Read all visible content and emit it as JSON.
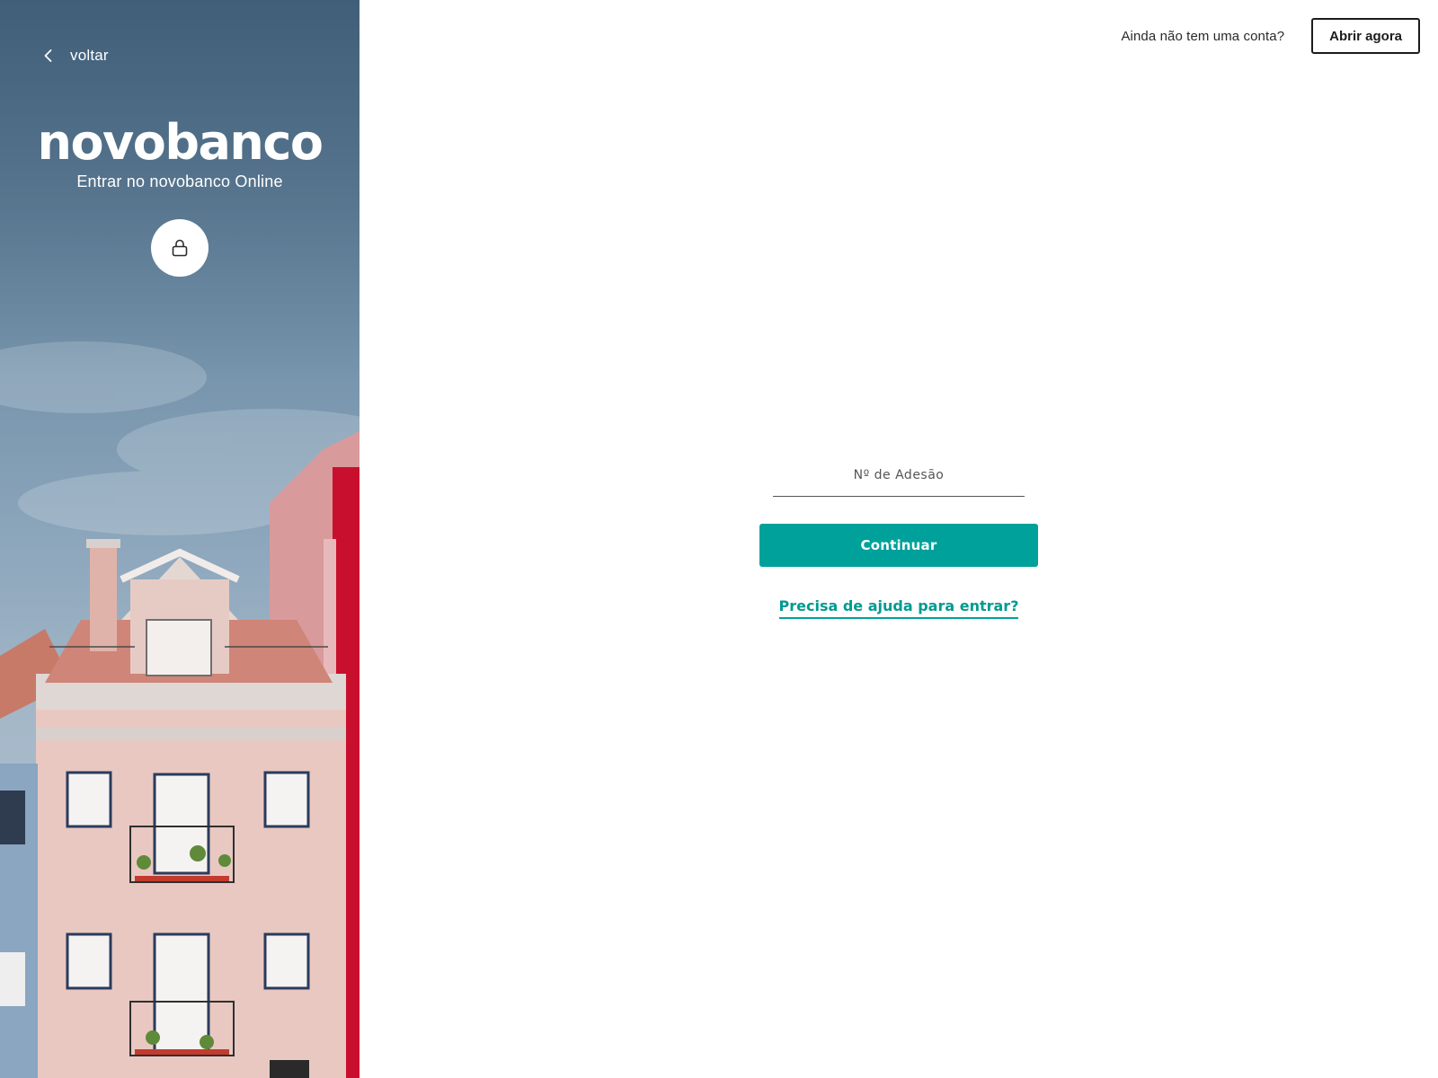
{
  "hero": {
    "back_label": "voltar",
    "brand_name": "novobanco",
    "subtitle": "Entrar no novobanco Online",
    "lock_icon": "lock-icon",
    "back_icon": "chevron-left-icon"
  },
  "topbar": {
    "question": "Ainda não tem uma conta?",
    "open_account_label": "Abrir agora"
  },
  "login": {
    "adesao_placeholder": "Nº de Adesão",
    "adesao_value": "",
    "continue_label": "Continuar",
    "help_link_label": "Precisa de ajuda para entrar?"
  },
  "colors": {
    "accent": "#00a19a",
    "text_dark": "#1c1c1c",
    "background": "#ffffff"
  }
}
